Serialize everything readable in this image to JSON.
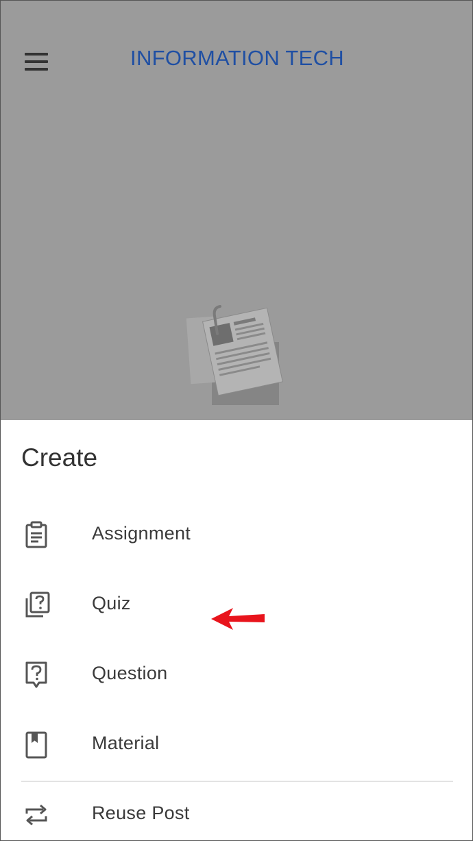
{
  "header": {
    "class_title": "INFORMATION TECH"
  },
  "create_sheet": {
    "title": "Create",
    "options": [
      {
        "label": "Assignment",
        "icon": "assignment-icon"
      },
      {
        "label": "Quiz",
        "icon": "quiz-icon"
      },
      {
        "label": "Question",
        "icon": "question-icon"
      },
      {
        "label": "Material",
        "icon": "material-icon"
      },
      {
        "label": "Reuse Post",
        "icon": "reuse-icon"
      }
    ]
  },
  "annotation": {
    "arrow_color": "#e8141c",
    "arrow_target": "Assignment"
  },
  "colors": {
    "backdrop": "#9b9b9b",
    "title_blue": "#1f4fa3",
    "icon_gray": "#555555"
  }
}
